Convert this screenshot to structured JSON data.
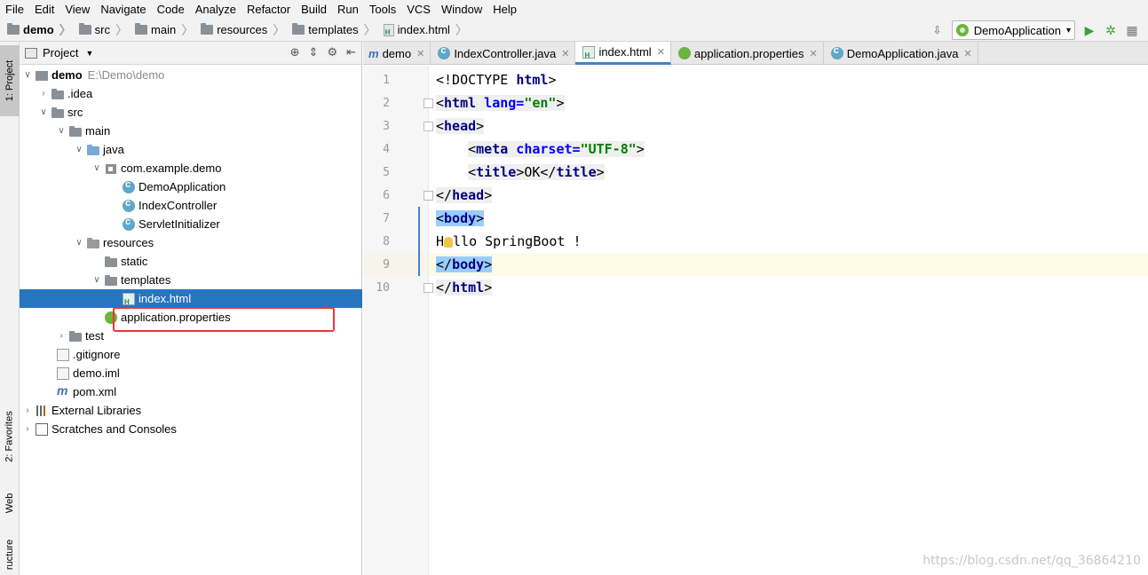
{
  "menu": [
    "File",
    "Edit",
    "View",
    "Navigate",
    "Code",
    "Analyze",
    "Refactor",
    "Build",
    "Run",
    "Tools",
    "VCS",
    "Window",
    "Help"
  ],
  "breadcrumb": [
    "demo",
    "src",
    "main",
    "resources",
    "templates",
    "index.html"
  ],
  "run_config": "DemoApplication",
  "strip": {
    "project": "1: Project",
    "favorites": "2: Favorites",
    "web": "Web",
    "structure": "ructure"
  },
  "project_panel": {
    "title": "Project"
  },
  "tree": [
    {
      "label": "demo",
      "extra": "E:\\Demo\\demo"
    },
    {
      "label": ".idea"
    },
    {
      "label": "src"
    },
    {
      "label": "main"
    },
    {
      "label": "java"
    },
    {
      "label": "com.example.demo"
    },
    {
      "label": "DemoApplication"
    },
    {
      "label": "IndexController"
    },
    {
      "label": "ServletInitializer"
    },
    {
      "label": "resources"
    },
    {
      "label": "static"
    },
    {
      "label": "templates"
    },
    {
      "label": "index.html"
    },
    {
      "label": "application.properties"
    },
    {
      "label": "test"
    },
    {
      "label": ".gitignore"
    },
    {
      "label": "demo.iml"
    },
    {
      "label": "pom.xml"
    },
    {
      "label": "External Libraries"
    },
    {
      "label": "Scratches and Consoles"
    }
  ],
  "tabs": [
    "demo",
    "IndexController.java",
    "index.html",
    "application.properties",
    "DemoApplication.java"
  ],
  "code": {
    "line_numbers": [
      "1",
      "2",
      "3",
      "4",
      "5",
      "6",
      "7",
      "8",
      "9",
      "10"
    ],
    "l1_a": "<!DOCTYPE ",
    "l1_b": "html",
    "l1_c": ">",
    "l2_lt": "<",
    "l2_tag": "html",
    "l2_attr": " lang=",
    "l2_val": "\"en\"",
    "l2_gt": ">",
    "l3_lt": "<",
    "l3_tag": "head",
    "l3_gt": ">",
    "l4_lt": "<",
    "l4_tag": "meta",
    "l4_attr": " charset=",
    "l4_val": "\"UTF-8\"",
    "l4_gt": ">",
    "l5_lt": "<",
    "l5_tag": "title",
    "l5_mid": ">OK</",
    "l5_tag2": "title",
    "l5_gt": ">",
    "l6_lt": "</",
    "l6_tag": "head",
    "l6_gt": ">",
    "l7_lt": "<",
    "l7_tag": "body",
    "l7_gt": ">",
    "l8_h": "H",
    "l8_rest": "llo SpringBoot !",
    "l9_lt": "</",
    "l9_tag": "body",
    "l9_gt": ">",
    "l10_lt": "</",
    "l10_tag": "html",
    "l10_gt": ">"
  },
  "watermark": "https://blog.csdn.net/qq_36864210",
  "colors": {
    "selection": "#2675bf",
    "highlight": "#fffae3",
    "annotation": "#ee3333"
  }
}
